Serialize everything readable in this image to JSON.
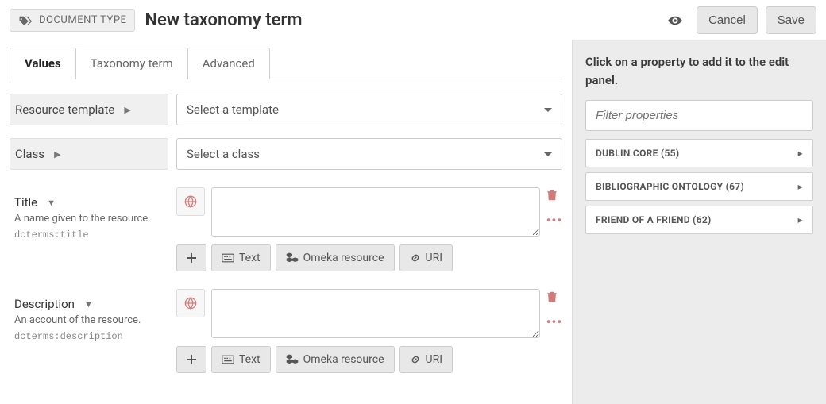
{
  "header": {
    "badge_label": "DOCUMENT TYPE",
    "title": "New taxonomy term",
    "cancel_label": "Cancel",
    "save_label": "Save"
  },
  "tabs": [
    {
      "label": "Values",
      "active": true
    },
    {
      "label": "Taxonomy term",
      "active": false
    },
    {
      "label": "Advanced",
      "active": false
    }
  ],
  "resource_template": {
    "label": "Resource template",
    "placeholder": "Select a template"
  },
  "class_select": {
    "label": "Class",
    "placeholder": "Select a class"
  },
  "properties": [
    {
      "name": "Title",
      "desc": "A name given to the resource.",
      "term": "dcterms:title",
      "value": ""
    },
    {
      "name": "Description",
      "desc": "An account of the resource.",
      "term": "dcterms:description",
      "value": ""
    }
  ],
  "value_types": {
    "text": "Text",
    "resource": "Omeka resource",
    "uri": "URI"
  },
  "sidebar": {
    "hint": "Click on a property to add it to the edit panel.",
    "filter_placeholder": "Filter properties",
    "vocabularies": [
      {
        "label": "DUBLIN CORE (55)"
      },
      {
        "label": "BIBLIOGRAPHIC ONTOLOGY (67)"
      },
      {
        "label": "FRIEND OF A FRIEND (62)"
      }
    ]
  }
}
